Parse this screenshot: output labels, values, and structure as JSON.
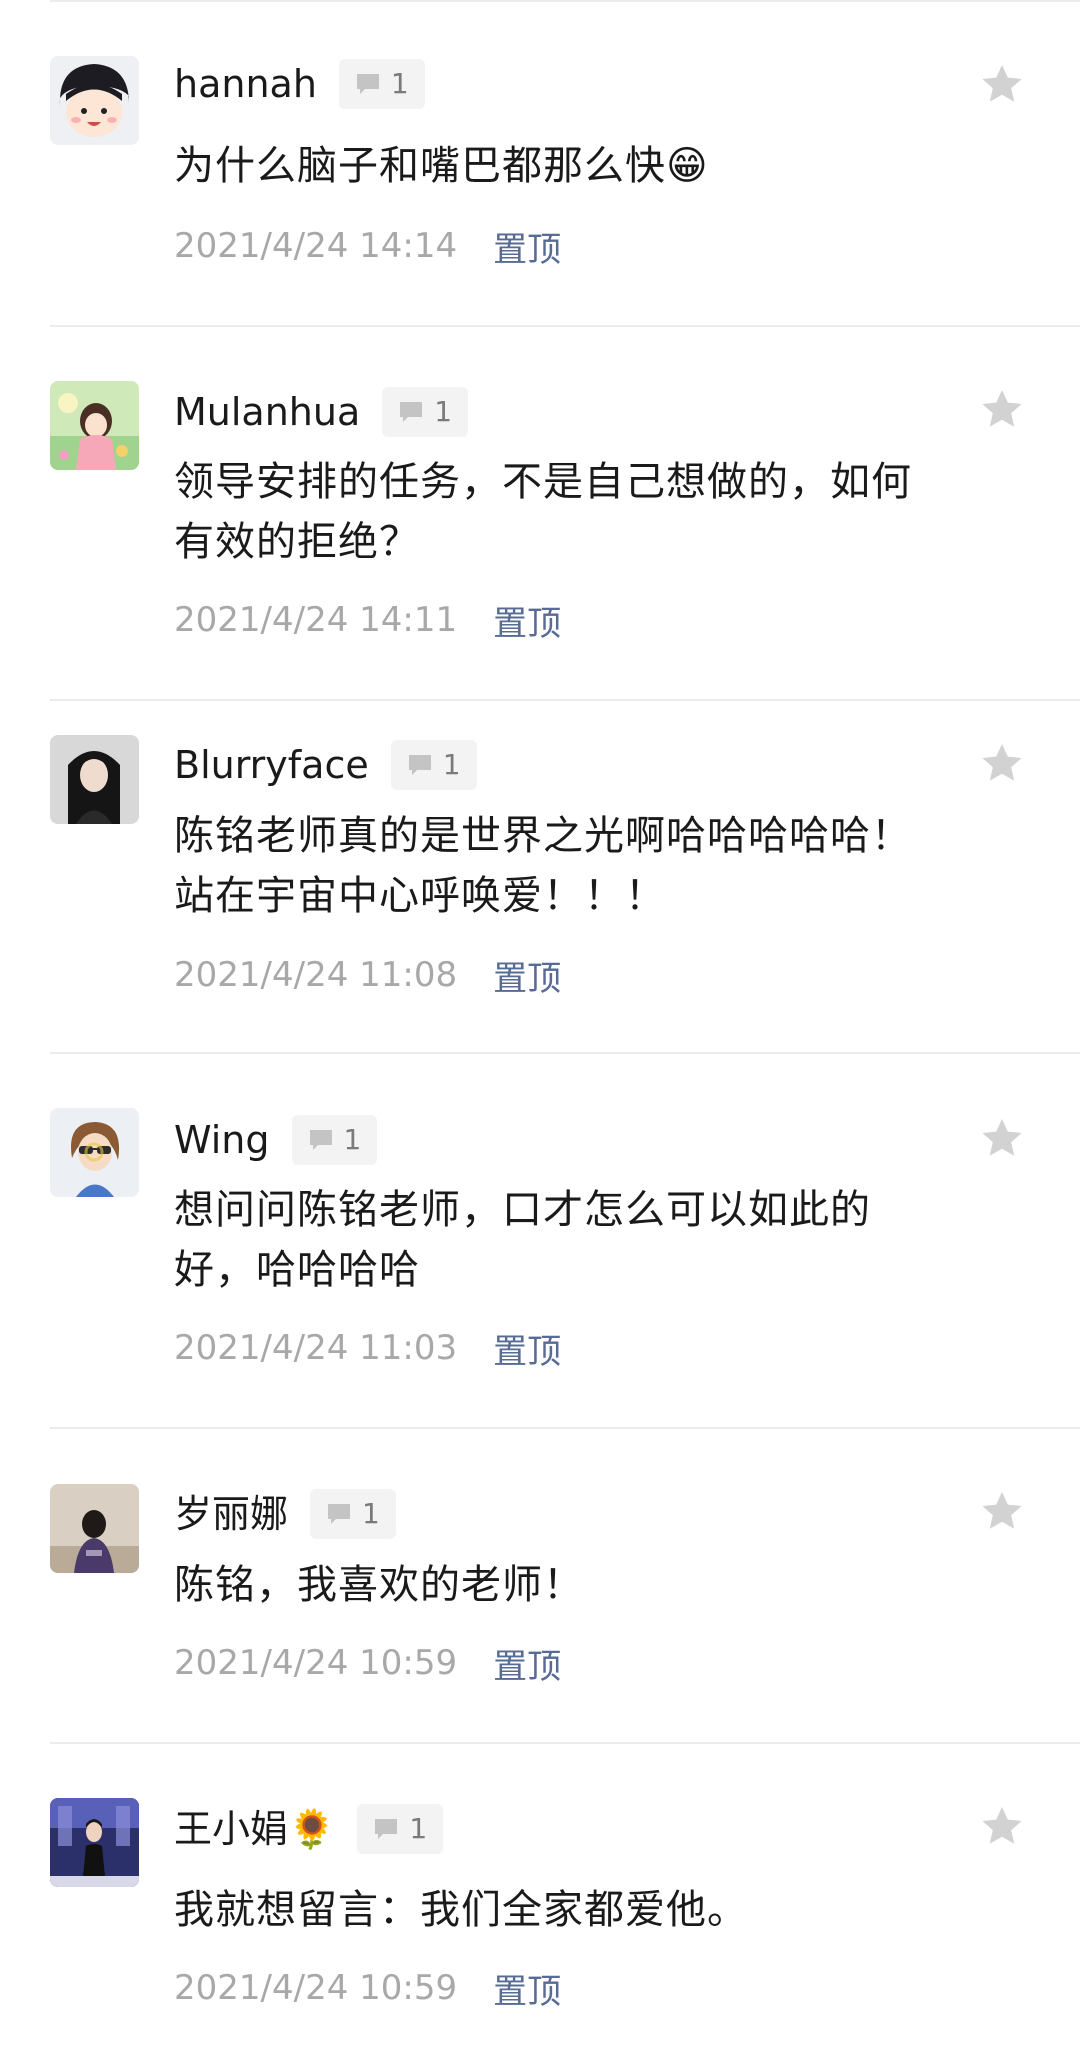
{
  "comments": [
    {
      "username": "hannah",
      "replies": "1",
      "text": "为什么脑子和嘴巴都那么快😁",
      "timestamp": "2021/4/24 14:14",
      "pin_label": "置顶",
      "avatar_icon": "cartoon-girl-avatar"
    },
    {
      "username": "Mulanhua",
      "replies": "1",
      "text": "领导安排的任务，不是自己想做的，如何有效的拒绝？",
      "timestamp": "2021/4/24 14:11",
      "pin_label": "置顶",
      "avatar_icon": "illustrated-girl-avatar"
    },
    {
      "username": "Blurryface",
      "replies": "1",
      "text": "陈铭老师真的是世界之光啊哈哈哈哈哈！站在宇宙中心呼唤爱！！！",
      "timestamp": "2021/4/24 11:08",
      "pin_label": "置顶",
      "avatar_icon": "photo-woman-dark-avatar"
    },
    {
      "username": "Wing",
      "replies": "1",
      "text": "想问问陈铭老师，口才怎么可以如此的好，哈哈哈哈",
      "timestamp": "2021/4/24 11:03",
      "pin_label": "置顶",
      "avatar_icon": "cartoon-sunglasses-avatar"
    },
    {
      "username": "岁丽娜",
      "replies": "1",
      "text": "陈铭，我喜欢的老师！",
      "timestamp": "2021/4/24 10:59",
      "pin_label": "置顶",
      "avatar_icon": "photo-back-view-avatar"
    },
    {
      "username": "王小娟🌻",
      "replies": "1",
      "text": "我就想留言：我们全家都爱他。",
      "timestamp": "2021/4/24 10:59",
      "pin_label": "置顶",
      "avatar_icon": "photo-stage-woman-avatar"
    }
  ],
  "colors": {
    "text": "#1a1a1a",
    "timestamp": "#a8a8a8",
    "pin_link": "#576b95",
    "star": "#d2d2d2",
    "badge_bg": "#f3f3f3",
    "divider": "#ececec"
  },
  "icons": {
    "reply": "comment-bubble-icon",
    "favorite": "star-icon"
  }
}
